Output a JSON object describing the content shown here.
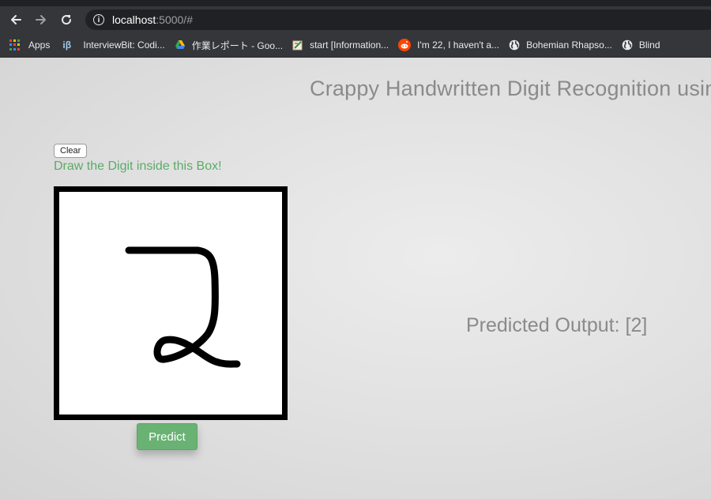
{
  "browser": {
    "url_host": "localhost",
    "url_rest": ":5000/#",
    "bookmarks": [
      {
        "label": "Apps",
        "icon": "apps-grid-icon"
      },
      {
        "label": "InterviewBit: Codi...",
        "icon": "interviewbit-icon"
      },
      {
        "label": "作業レポート - Goo...",
        "icon": "google-drive-icon"
      },
      {
        "label": "start [Information...",
        "icon": "dokuwiki-icon"
      },
      {
        "label": "I'm 22, I haven't a...",
        "icon": "reddit-icon"
      },
      {
        "label": "Bohemian Rhapso...",
        "icon": "globe-icon"
      },
      {
        "label": "Blind",
        "icon": "globe-icon"
      }
    ]
  },
  "page": {
    "title": "Crappy Handwritten Digit Recognition using S",
    "clear_label": "Clear",
    "instruction": "Draw the Digit inside this Box!",
    "predict_label": "Predict",
    "output": "Predicted Output: [2]"
  },
  "colors": {
    "accent_green": "#5cab68",
    "button_green": "#69b274",
    "text_gray": "#8a8a8a",
    "chrome_dark": "#35363a"
  }
}
